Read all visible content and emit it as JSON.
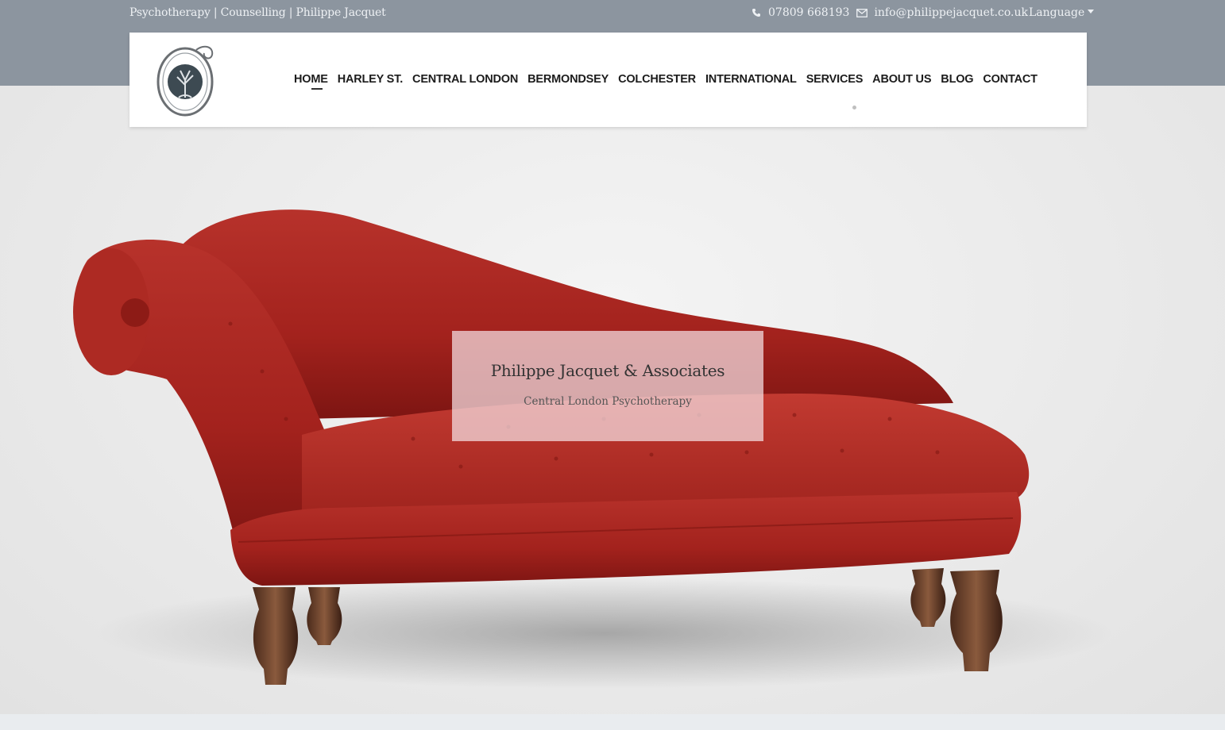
{
  "topbar": {
    "tagline": "Psychotherapy | Counselling | Philippe Jacquet",
    "phone": "07809 668193",
    "email": "info@philippejacquet.co.uk",
    "language_label": "Language"
  },
  "nav": {
    "items": [
      {
        "label": "HOME",
        "active": true
      },
      {
        "label": "HARLEY ST."
      },
      {
        "label": "CENTRAL LONDON"
      },
      {
        "label": "BERMONDSEY"
      },
      {
        "label": "COLCHESTER"
      },
      {
        "label": "INTERNATIONAL"
      },
      {
        "label": "SERVICES"
      },
      {
        "label": "ABOUT US"
      },
      {
        "label": "BLOG"
      },
      {
        "label": "CONTACT"
      }
    ]
  },
  "hero": {
    "title": "Philippe Jacquet & Associates",
    "subtitle": "Central London Psychotherapy",
    "image": "red-velvet-chaise-longue"
  },
  "icons": {
    "phone": "phone-icon",
    "email": "envelope-icon",
    "language": "caret-down-icon",
    "logo": "tree-of-life-logo-icon"
  },
  "colors": {
    "topbar": "#8c959f",
    "sofa": "#a3221d",
    "nav_text": "#1c1c1c"
  }
}
